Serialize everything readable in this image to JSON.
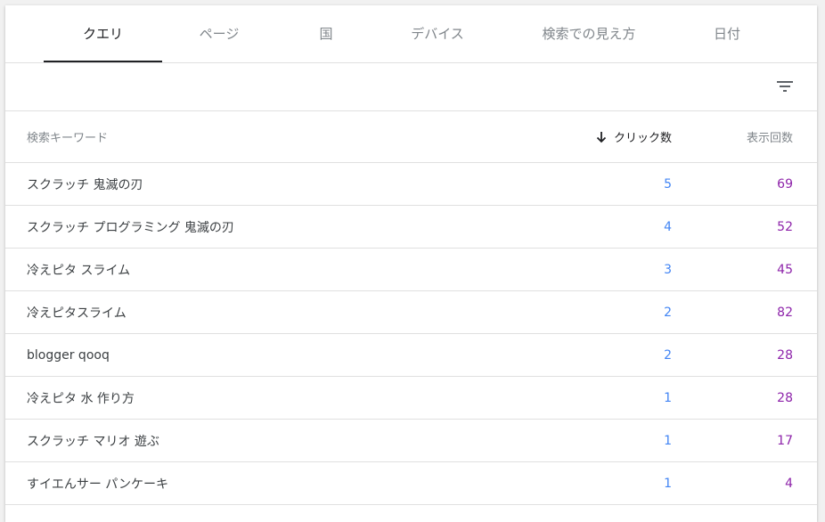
{
  "tabs": [
    {
      "label": "クエリ",
      "active": true
    },
    {
      "label": "ページ",
      "active": false
    },
    {
      "label": "国",
      "active": false
    },
    {
      "label": "デバイス",
      "active": false
    },
    {
      "label": "検索での見え方",
      "active": false
    },
    {
      "label": "日付",
      "active": false
    }
  ],
  "toolbar": {
    "filter_icon": "filter-list-icon"
  },
  "table": {
    "headers": {
      "query": "検索キーワード",
      "clicks": "クリック数",
      "impressions": "表示回数"
    },
    "sort": {
      "column": "clicks",
      "direction": "descending",
      "icon": "arrow-down-icon"
    },
    "rows": [
      {
        "query": "スクラッチ 鬼滅の刃",
        "clicks": "5",
        "impressions": "69"
      },
      {
        "query": "スクラッチ プログラミング 鬼滅の刃",
        "clicks": "4",
        "impressions": "52"
      },
      {
        "query": "冷えピタ スライム",
        "clicks": "3",
        "impressions": "45"
      },
      {
        "query": "冷えピタスライム",
        "clicks": "2",
        "impressions": "82"
      },
      {
        "query": "blogger qooq",
        "clicks": "2",
        "impressions": "28"
      },
      {
        "query": "冷えピタ 水 作り方",
        "clicks": "1",
        "impressions": "28"
      },
      {
        "query": "スクラッチ マリオ 遊ぶ",
        "clicks": "1",
        "impressions": "17"
      },
      {
        "query": "すイエんサー パンケーキ",
        "clicks": "1",
        "impressions": "4"
      }
    ]
  },
  "colors": {
    "clicks": "#4285f4",
    "impressions": "#8e24aa",
    "active_tab": "#202124",
    "inactive_tab": "#80868b"
  }
}
